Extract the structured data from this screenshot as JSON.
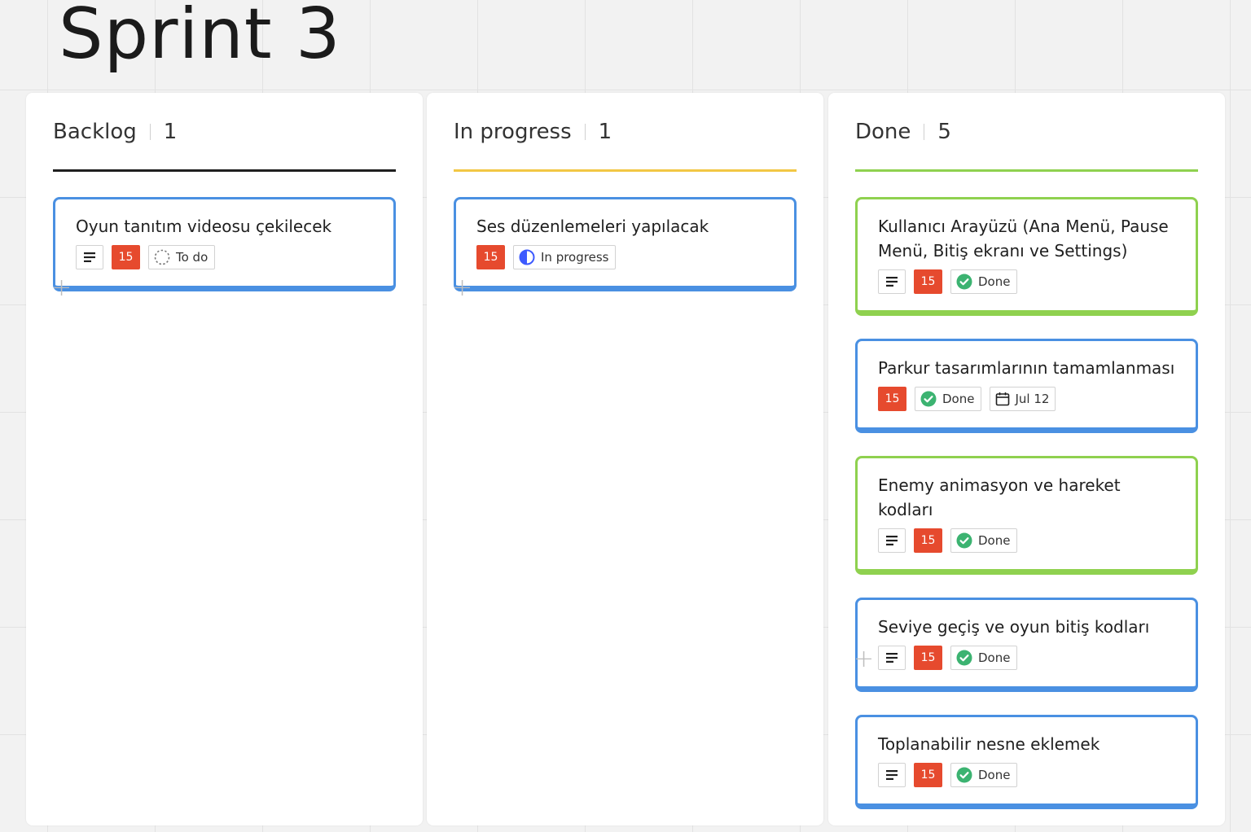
{
  "board": {
    "title": "Sprint 3"
  },
  "columns": [
    {
      "name": "Backlog",
      "count": "1",
      "line_color": "#1f1f1f",
      "add_label": "+",
      "cards": [
        {
          "title": "Oyun tanıtım videosu çekilecek",
          "border": "blue",
          "has_notes": true,
          "points": "15",
          "status": "To do",
          "status_icon": "todo-icon"
        }
      ]
    },
    {
      "name": "In progress",
      "count": "1",
      "line_color": "#f2c744",
      "add_label": "+",
      "cards": [
        {
          "title": "Ses düzenlemeleri yapılacak",
          "border": "blue",
          "has_notes": false,
          "points": "15",
          "status": "In progress",
          "status_icon": "in-progress-icon"
        }
      ]
    },
    {
      "name": "Done",
      "count": "5",
      "line_color": "#8fd14f",
      "add_label": "+",
      "cards": [
        {
          "title": "Kullanıcı Arayüzü (Ana Menü, Pause Menü, Bitiş ekranı ve Settings)",
          "border": "green",
          "has_notes": true,
          "points": "15",
          "status": "Done",
          "status_icon": "done-icon"
        },
        {
          "title": "Parkur tasarımlarının tamamlanması",
          "border": "blue",
          "has_notes": false,
          "points": "15",
          "status": "Done",
          "status_icon": "done-icon",
          "date": "Jul 12"
        },
        {
          "title": "Enemy animasyon ve hareket kodları",
          "border": "green",
          "has_notes": true,
          "points": "15",
          "status": "Done",
          "status_icon": "done-icon"
        },
        {
          "title": "Seviye geçiş ve oyun bitiş kodları",
          "border": "blue",
          "has_notes": true,
          "points": "15",
          "status": "Done",
          "status_icon": "done-icon"
        },
        {
          "title": "Toplanabilir nesne eklemek",
          "border": "blue",
          "has_notes": true,
          "points": "15",
          "status": "Done",
          "status_icon": "done-icon"
        }
      ]
    }
  ],
  "colors": {
    "blue_border": "#4a90e2",
    "green_border": "#8fd14f",
    "points_chip": "#e64a2e",
    "done_icon": "#3cb371",
    "in_progress_icon": "#3d5afe"
  }
}
